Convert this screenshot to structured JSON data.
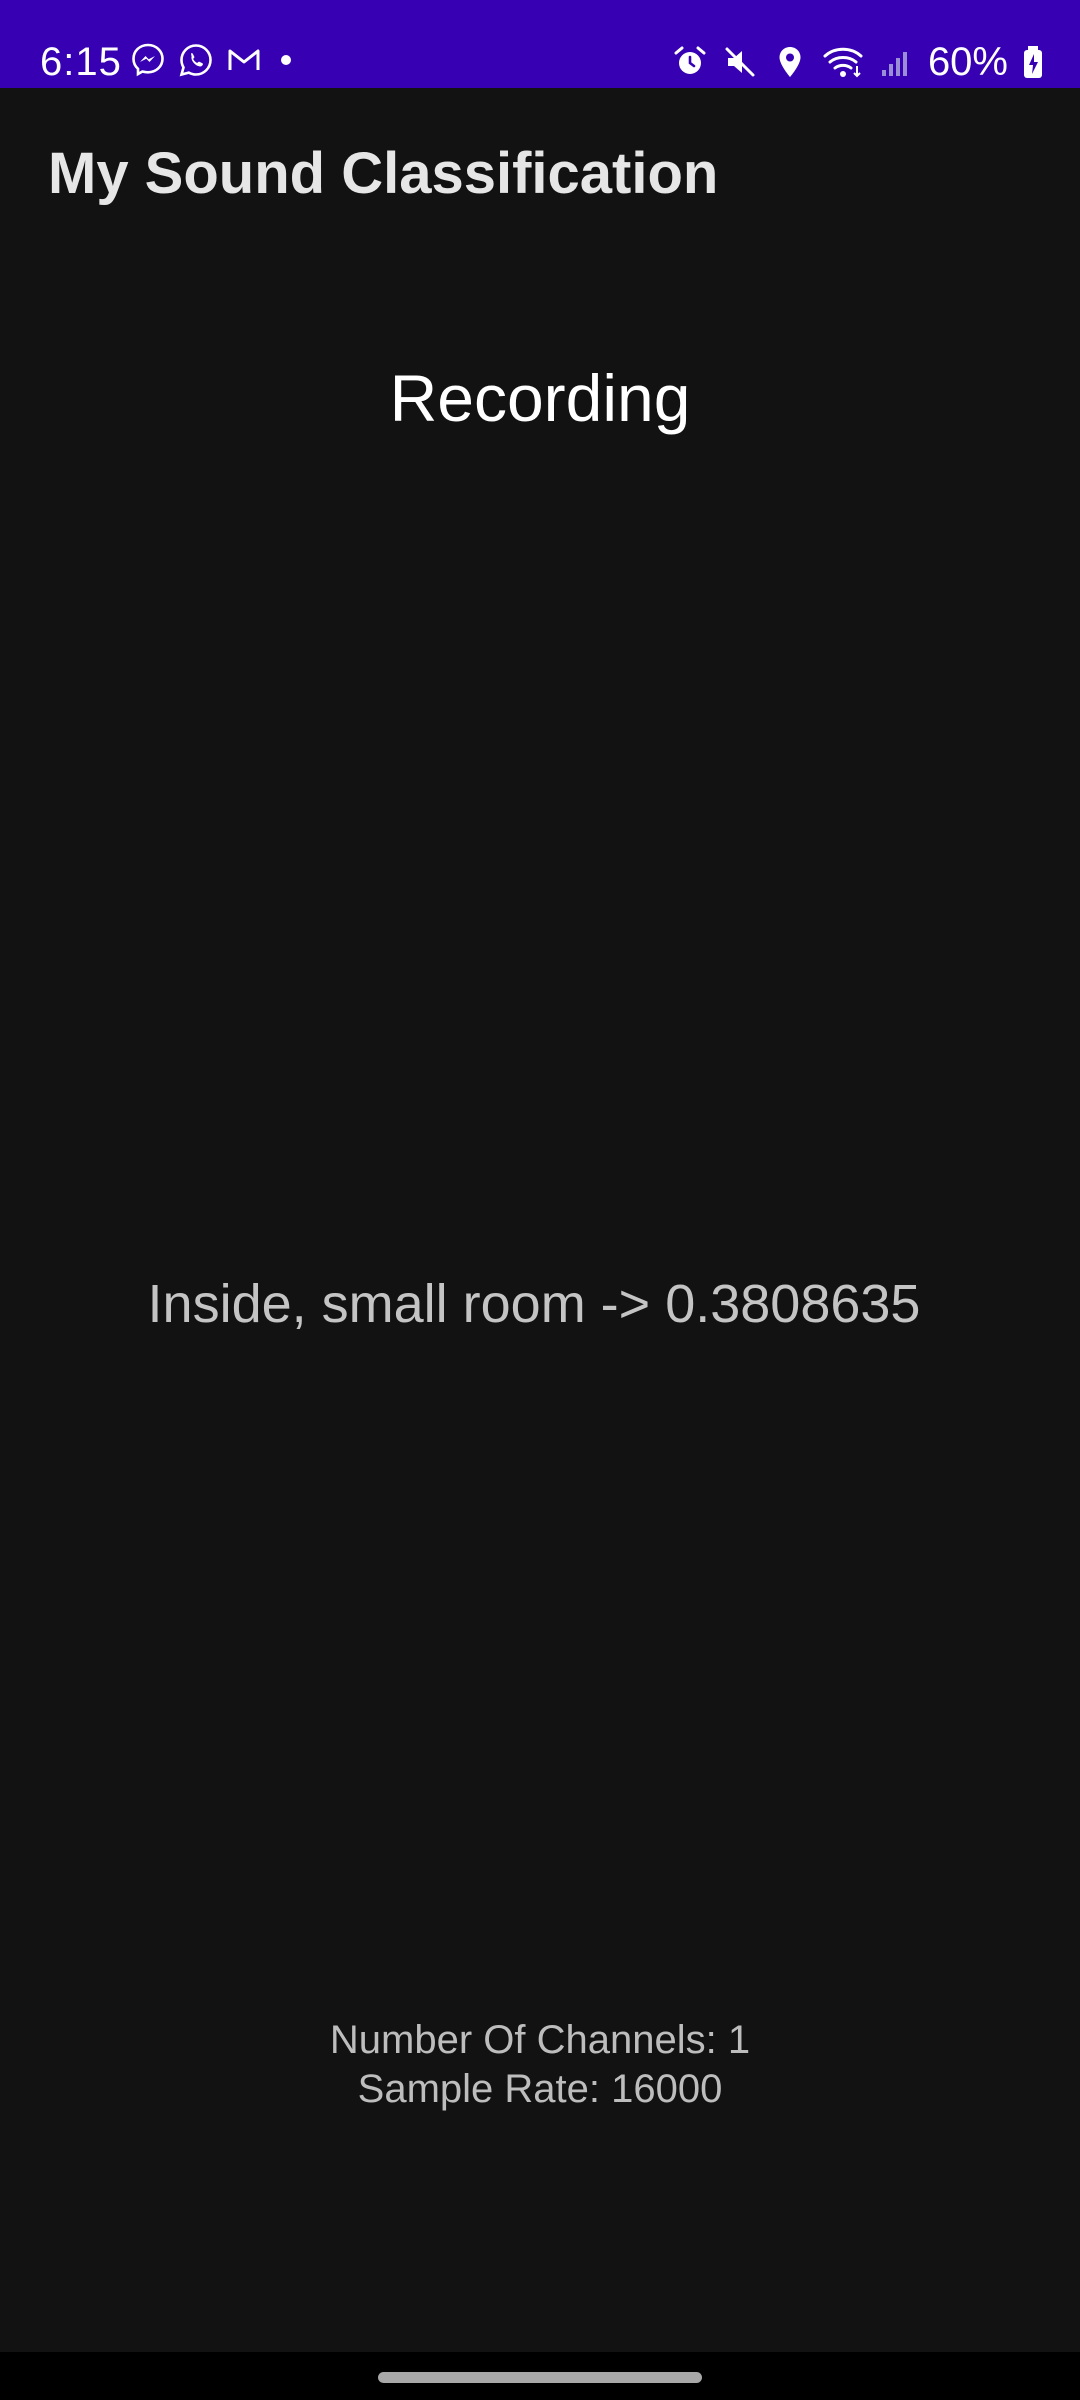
{
  "status_bar": {
    "time": "6:15",
    "battery": "60%",
    "colors": {
      "background": "#3700b3",
      "foreground": "#ffffff"
    },
    "left_icons": [
      "messenger-icon",
      "whatsapp-icon",
      "gmail-icon",
      "notification-dot-icon"
    ],
    "right_icons": [
      "alarm-icon",
      "mute-icon",
      "location-icon",
      "wifi-icon",
      "signal-icon",
      "battery-charging-icon"
    ]
  },
  "app_bar": {
    "title": "My Sound Classification"
  },
  "main": {
    "status_label": "Recording",
    "classification_result": "Inside, small room -> 0.3808635",
    "channels_text": "Number Of Channels: 1",
    "sample_rate_text": "Sample Rate: 16000"
  },
  "theme": {
    "background": "#121212",
    "nav_bar": "#000000"
  }
}
